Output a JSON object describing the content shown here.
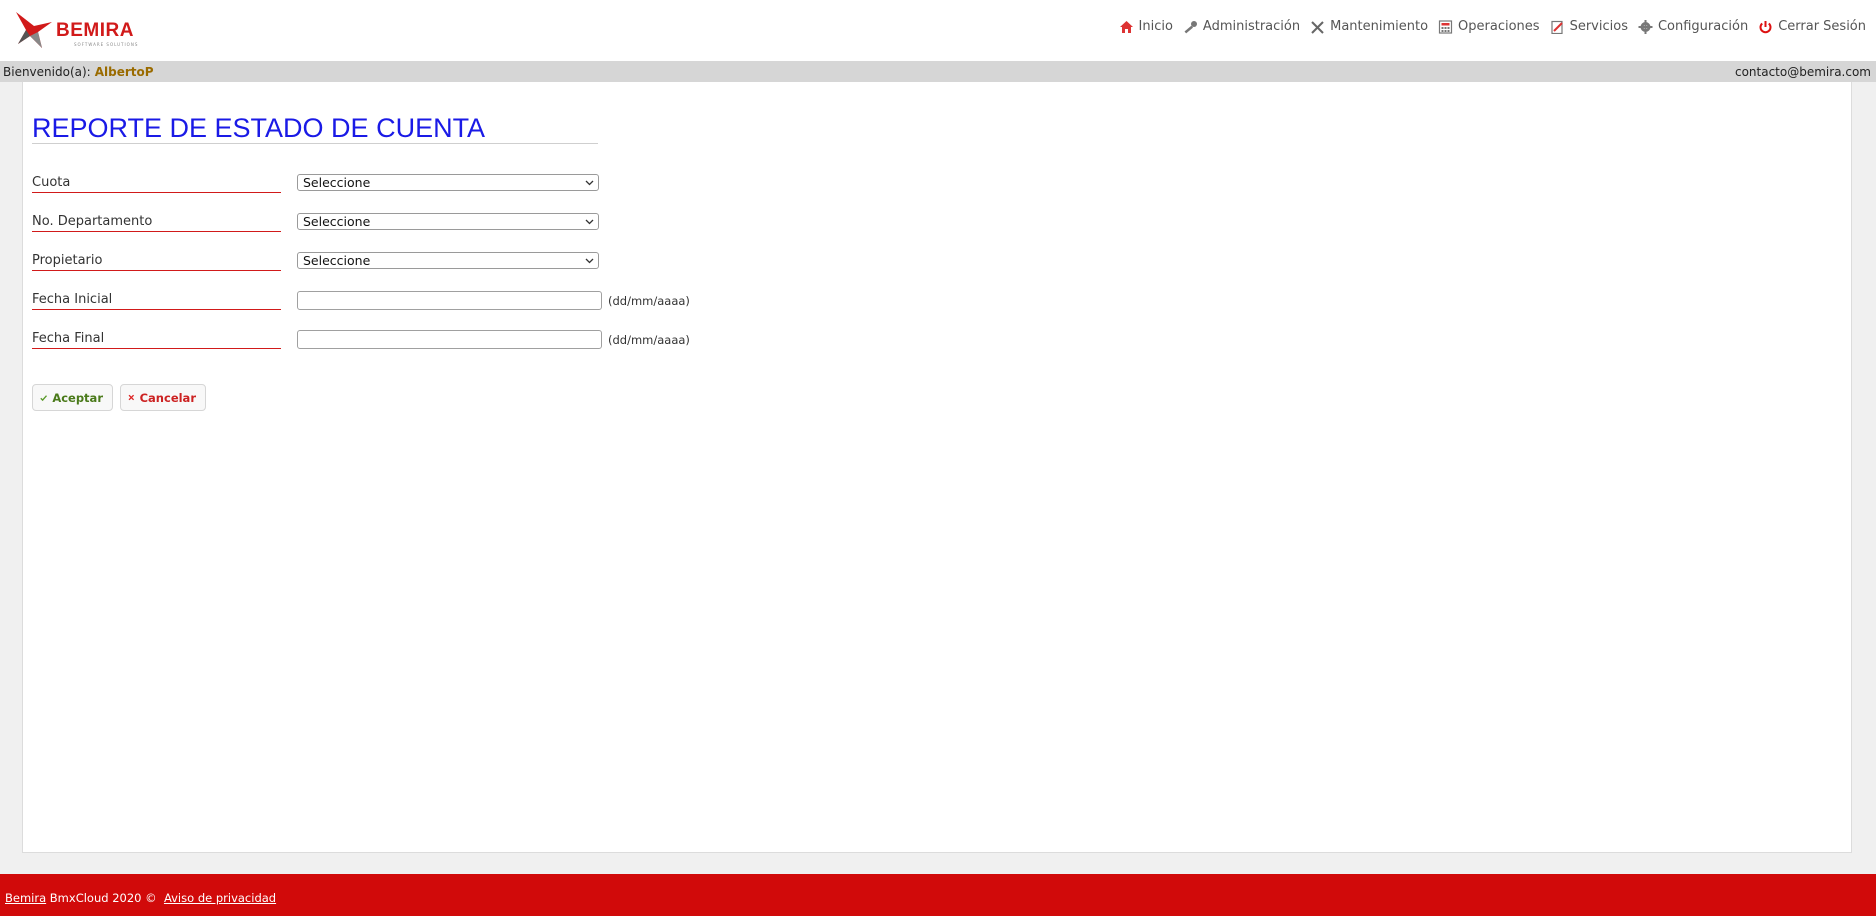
{
  "brand": {
    "name": "BEMIRA",
    "tagline": "SOFTWARE SOLUTIONS"
  },
  "nav": [
    {
      "label": "Inicio",
      "icon": "home-icon"
    },
    {
      "label": "Administración",
      "icon": "key-icon"
    },
    {
      "label": "Mantenimiento",
      "icon": "tools-icon"
    },
    {
      "label": "Operaciones",
      "icon": "calculator-icon"
    },
    {
      "label": "Servicios",
      "icon": "clipboard-icon"
    },
    {
      "label": "Configuración",
      "icon": "gear-icon"
    },
    {
      "label": "Cerrar Sesión",
      "icon": "power-icon"
    }
  ],
  "welcome": {
    "prefix": "Bienvenido(a):",
    "user": "AlbertoP",
    "contact": "contacto@bemira.com"
  },
  "page": {
    "title": "REPORTE DE ESTADO DE CUENTA"
  },
  "form": {
    "cuota": {
      "label": "Cuota",
      "value": "Seleccione"
    },
    "departamento": {
      "label": "No. Departamento",
      "value": "Seleccione"
    },
    "propietario": {
      "label": "Propietario",
      "value": "Seleccione"
    },
    "fecha_inicial": {
      "label": "Fecha Inicial",
      "value": "",
      "hint": "(dd/mm/aaaa)"
    },
    "fecha_final": {
      "label": "Fecha Final",
      "value": "",
      "hint": "(dd/mm/aaaa)"
    }
  },
  "buttons": {
    "accept": "Aceptar",
    "cancel": "Cancelar"
  },
  "footer": {
    "brand_link": "Bemira",
    "text": "BmxCloud 2020 ©",
    "privacy_link": "Aviso de privacidad"
  },
  "colors": {
    "accent_red": "#d10a0a",
    "title_blue": "#1a1ae6",
    "user_gold": "#9a6b00"
  }
}
